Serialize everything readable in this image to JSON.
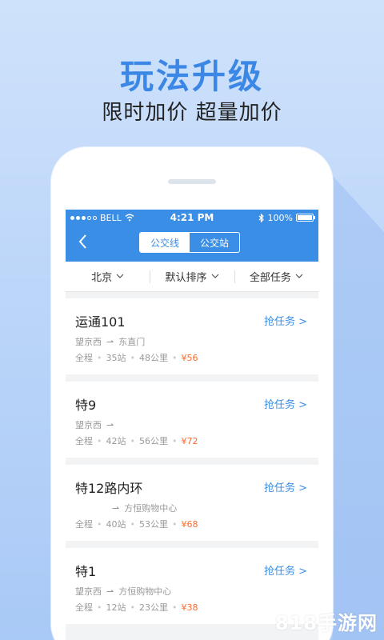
{
  "promo": {
    "title": "玩法升级",
    "subtitle": "限时加价 超量加价"
  },
  "status": {
    "carrier": "BELL",
    "time": "4:21 PM",
    "battery": "100%"
  },
  "nav": {
    "tabs": [
      {
        "label": "公交线",
        "active": true
      },
      {
        "label": "公交站",
        "active": false
      }
    ]
  },
  "filters": [
    {
      "label": "北京"
    },
    {
      "label": "默认排序"
    },
    {
      "label": "全部任务"
    }
  ],
  "tasks": [
    {
      "title": "运通101",
      "from": "望京西",
      "to": "东直门",
      "scope": "全程",
      "stops": "35站",
      "distance": "48公里",
      "price": "¥56",
      "action": "抢任务 >"
    },
    {
      "title": "特9",
      "from": "望京西",
      "to": "",
      "scope": "全程",
      "stops": "42站",
      "distance": "56公里",
      "price": "¥72",
      "action": "抢任务 >"
    },
    {
      "title": "特12路内环",
      "from": "",
      "to": "方恒购物中心",
      "scope": "全程",
      "stops": "40站",
      "distance": "53公里",
      "price": "¥68",
      "action": "抢任务 >"
    },
    {
      "title": "特1",
      "from": "望京西",
      "to": "方恒购物中心",
      "scope": "全程",
      "stops": "12站",
      "distance": "23公里",
      "price": "¥38",
      "action": "抢任务 >"
    }
  ],
  "watermark": "818手游网",
  "colors": {
    "accent": "#3a8ee6",
    "price": "#ff6a2b"
  }
}
